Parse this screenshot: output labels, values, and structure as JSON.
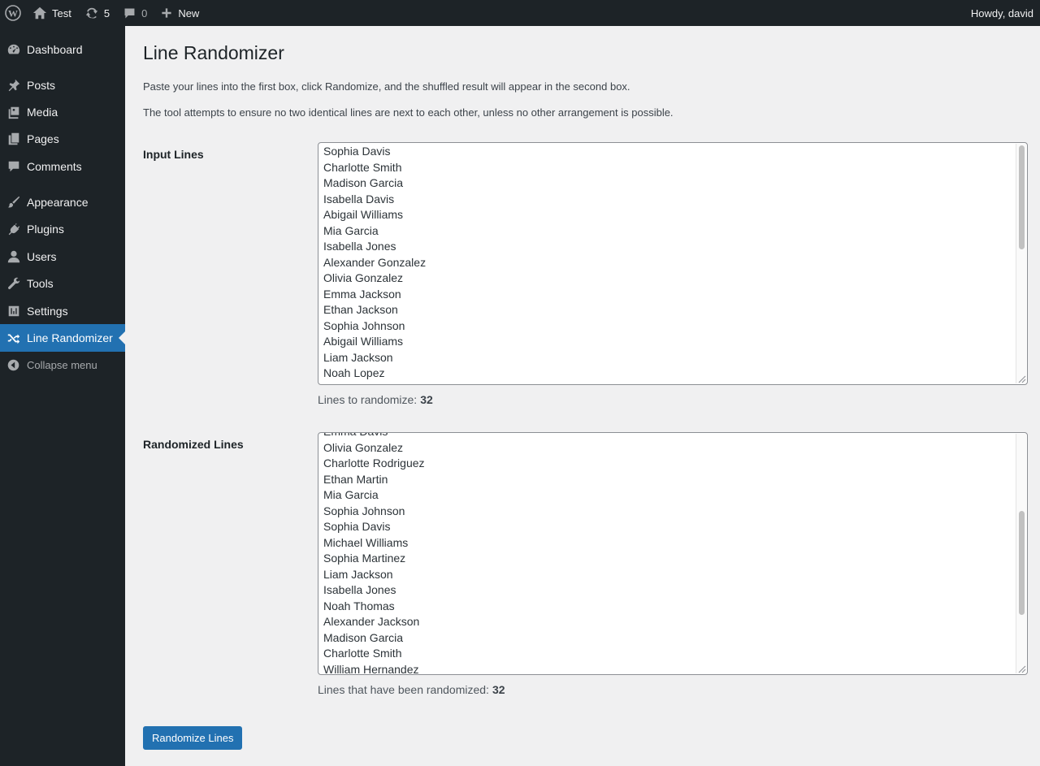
{
  "adminbar": {
    "site_name": "Test",
    "updates_count": "5",
    "comments_count": "0",
    "new_label": "New",
    "howdy": "Howdy, david"
  },
  "sidebar": {
    "items": [
      {
        "label": "Dashboard",
        "icon": "dashboard-icon"
      },
      {
        "label": "Posts",
        "icon": "pin-icon"
      },
      {
        "label": "Media",
        "icon": "media-icon"
      },
      {
        "label": "Pages",
        "icon": "pages-icon"
      },
      {
        "label": "Comments",
        "icon": "comment-icon"
      },
      {
        "label": "Appearance",
        "icon": "brush-icon"
      },
      {
        "label": "Plugins",
        "icon": "plug-icon"
      },
      {
        "label": "Users",
        "icon": "user-icon"
      },
      {
        "label": "Tools",
        "icon": "wrench-icon"
      },
      {
        "label": "Settings",
        "icon": "settings-icon"
      },
      {
        "label": "Line Randomizer",
        "icon": "shuffle-icon"
      }
    ],
    "collapse_label": "Collapse menu"
  },
  "page": {
    "title": "Line Randomizer",
    "desc1": "Paste your lines into the first box, click Randomize, and the shuffled result will appear in the second box.",
    "desc2": "The tool attempts to ensure no two identical lines are next to each other, unless no other arrangement is possible.",
    "input_label": "Input Lines",
    "input_lines": [
      "Sophia Davis",
      "Charlotte Smith",
      "Madison Garcia",
      "Isabella Davis",
      "Abigail Williams",
      "Mia Garcia",
      "Isabella Jones",
      "Alexander Gonzalez",
      "Olivia Gonzalez",
      "Emma Jackson",
      "Ethan Jackson",
      "Sophia Johnson",
      "Abigail Williams",
      "Liam Jackson",
      "Noah Lopez"
    ],
    "input_count_label": "Lines to randomize:",
    "input_count": "32",
    "output_label": "Randomized Lines",
    "output_lines": [
      "Emma Davis",
      "Olivia Gonzalez",
      "Charlotte Rodriguez",
      "Ethan Martin",
      "Mia Garcia",
      "Sophia Johnson",
      "Sophia Davis",
      "Michael Williams",
      "Sophia Martinez",
      "Liam Jackson",
      "Isabella Jones",
      "Noah Thomas",
      "Alexander Jackson",
      "Madison Garcia",
      "Charlotte Smith",
      "William Hernandez"
    ],
    "output_count_label": "Lines that have been randomized:",
    "output_count": "32",
    "button_label": "Randomize Lines"
  }
}
